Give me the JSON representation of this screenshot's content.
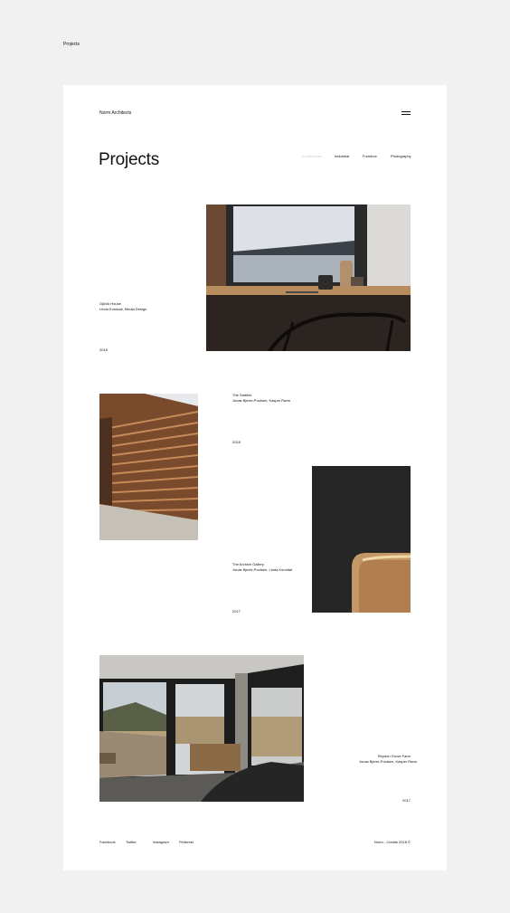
{
  "page_label": "Projects",
  "brand": "Norm Architects",
  "title": "Projects",
  "filters": [
    {
      "label": "Architecture",
      "active": true
    },
    {
      "label": "Industrial",
      "active": false
    },
    {
      "label": "Furniture",
      "active": false
    },
    {
      "label": "Photography",
      "active": false
    }
  ],
  "projects": [
    {
      "name": "Gjövik House",
      "credits": "Linda Kornidal, Media Design",
      "year": "2018"
    },
    {
      "name": "The Stables",
      "credits": "Jonas Bjerre-Poulsen, Kasper Rønn",
      "year": "2018"
    },
    {
      "name": "The Archive Gallery",
      "credits": "Jonas Bjerre-Poulsen, Linda Kornidal",
      "year": "2017"
    },
    {
      "name": "Reydon Grove Farm",
      "credits": "Jonas Bjerre-Poulsen, Kasper Rønn",
      "year": "2017"
    }
  ],
  "footer": {
    "links": [
      "Facebook",
      "Twitter",
      "Instagram",
      "Pinterest"
    ],
    "copyright": "© 2018 Norm - Credits"
  }
}
